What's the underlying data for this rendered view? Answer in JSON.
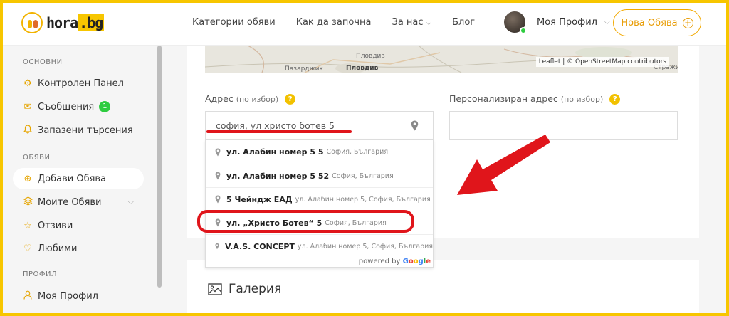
{
  "logo": {
    "text": "hora",
    "tld": ".bg"
  },
  "nav": {
    "items": [
      "Категории обяви",
      "Как да започна",
      "За нас",
      "Блог"
    ]
  },
  "profile": {
    "name": "Моя Профил"
  },
  "new_ad": {
    "label": "Нова Обява"
  },
  "sidebar": {
    "sections": [
      "ОСНОВНИ",
      "ОБЯВИ",
      "ПРОФИЛ"
    ],
    "items": [
      {
        "label": "Контролен Панел",
        "icon": "gear-icon"
      },
      {
        "label": "Съобщения",
        "icon": "envelope-icon",
        "badge": "1"
      },
      {
        "label": "Запазени търсения",
        "icon": "bell-icon"
      },
      {
        "label": "Добави Обява",
        "icon": "plus-circle-icon"
      },
      {
        "label": "Моите Обяви",
        "icon": "layers-icon"
      },
      {
        "label": "Отзиви",
        "icon": "star-icon"
      },
      {
        "label": "Любими",
        "icon": "heart-icon"
      },
      {
        "label": "Моя Профил",
        "icon": "user-icon"
      }
    ]
  },
  "map": {
    "attribution_leaflet": "Leaflet",
    "attribution_rest": "| © OpenStreetMap contributors",
    "labels": [
      "Пловдив",
      "Пазарджик",
      "Пловдив",
      "Стражица"
    ]
  },
  "address_field": {
    "label": "Адрес",
    "optional": "(по избор)",
    "value": "софия, ул христо ботев 5"
  },
  "custom_address_field": {
    "label": "Персонализиран адрес",
    "optional": "(по избор)",
    "value": ""
  },
  "suggestions": [
    {
      "main": "ул. Алабин номер 5 5",
      "secondary": "София, България"
    },
    {
      "main": "ул. Алабин номер 5 52",
      "secondary": "София, България"
    },
    {
      "main": "5 Чейндж ЕАД",
      "secondary": "ул. Алабин номер 5, София, България"
    },
    {
      "main": "ул. „Христо Ботев“ 5",
      "secondary": "София, България"
    },
    {
      "main": "V.A.S. CONCEPT",
      "secondary": "ул. Алабин номер 5, София, България"
    }
  ],
  "powered_by": {
    "prefix": "powered by",
    "google": [
      "G",
      "o",
      "o",
      "g",
      "l",
      "e"
    ]
  },
  "gallery": {
    "title": "Галерия"
  },
  "colors": {
    "accent": "#f7c600",
    "highlight": "#e0151b",
    "badge": "#2ecc40"
  }
}
